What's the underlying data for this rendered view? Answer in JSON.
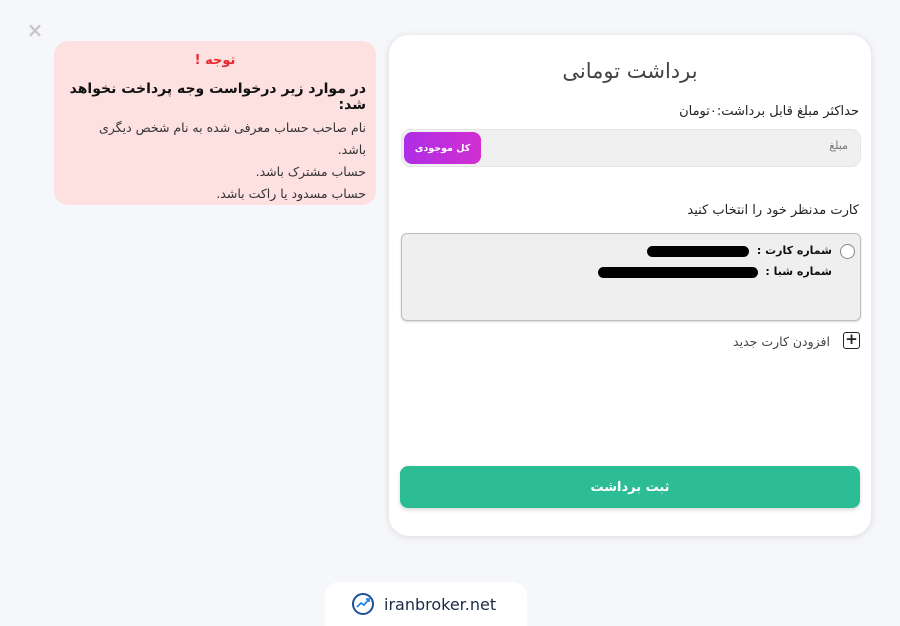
{
  "modal": {
    "close_label": "×"
  },
  "warning": {
    "title": "توجه !",
    "heading": "در موارد زیر درخواست وجه پرداخت نخواهد شد:",
    "lines": [
      "نام صاحب حساب معرفی شده به نام شخص دیگری",
      "باشد.",
      "حساب مشترک باشد.",
      "حساب مسدود یا راکت باشد."
    ]
  },
  "withdraw": {
    "title": "برداشت تومانی",
    "max_amount": "حداکثر مبلغ قابل برداشت:۰تومان",
    "amount_placeholder": "مبلغ",
    "all_balance_label": "کل موجودی",
    "select_card_label": "کارت مدنظر خود را انتخاب کنید",
    "card": {
      "card_number_label": "شماره کارت :",
      "sheba_label": "شماره شبا :"
    },
    "add_card_label": "افزودن کارت جدید",
    "submit_label": "ثبت برداشت"
  },
  "watermark": {
    "text": "iranbroker.net"
  },
  "colors": {
    "accent_green": "#2dbd94",
    "accent_purple": "#c02edb",
    "warning_bg": "#fde0e0",
    "warning_red": "#e8262b"
  }
}
